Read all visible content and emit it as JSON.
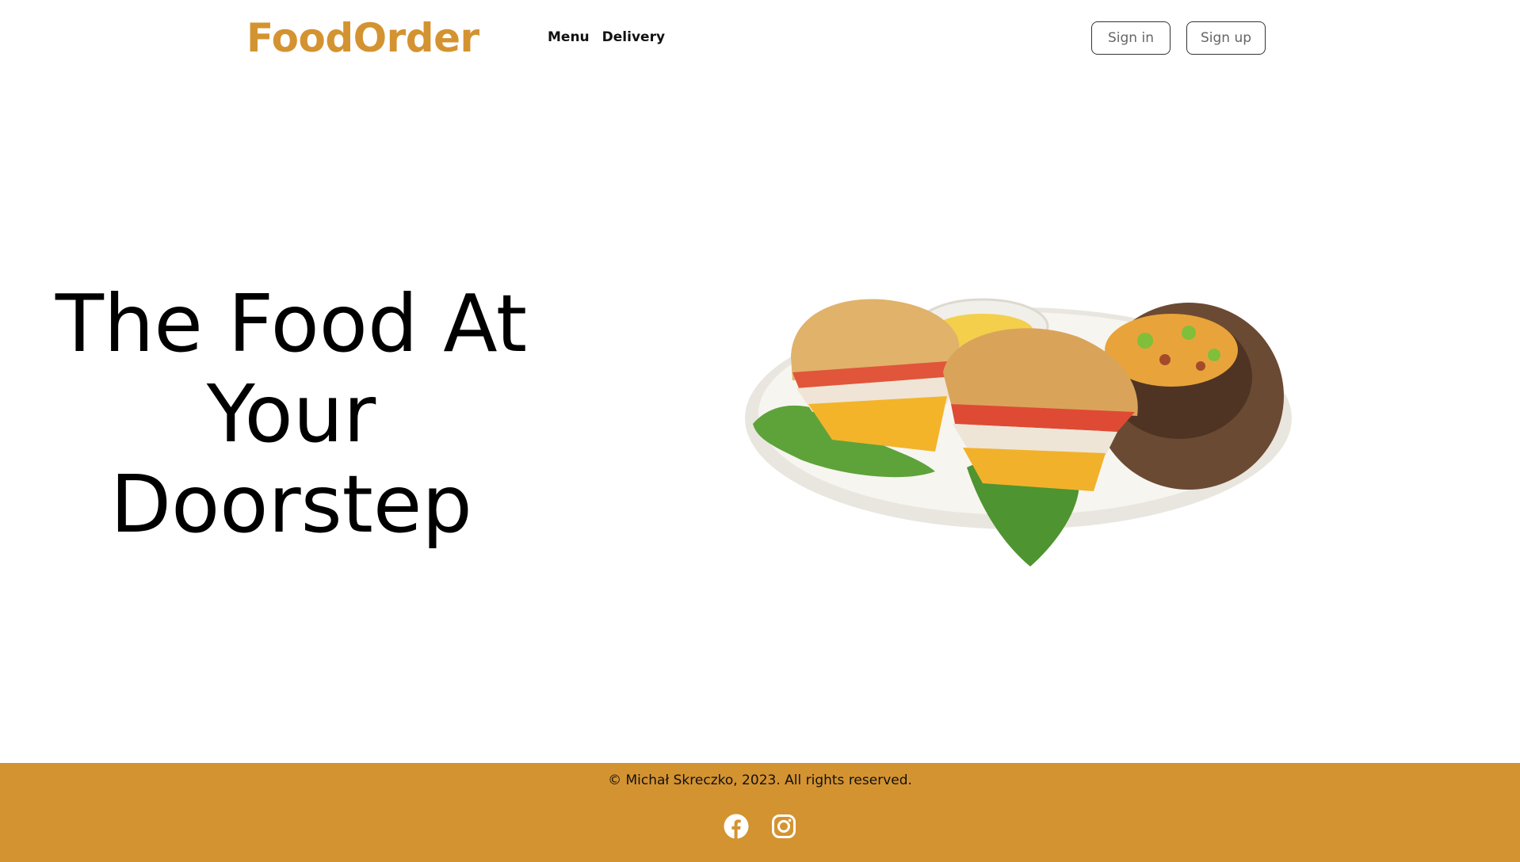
{
  "header": {
    "logo": "FoodOrder",
    "nav": [
      {
        "label": "Menu"
      },
      {
        "label": "Delivery"
      }
    ],
    "auth": {
      "signin_label": "Sign in",
      "signup_label": "Sign up"
    }
  },
  "hero": {
    "title_lines": [
      "The Food At",
      "Your",
      "Doorstep"
    ],
    "image_icon": "food-plate-image"
  },
  "footer": {
    "copyright": "© Michał Skreczko, 2023. All rights reserved.",
    "socials": [
      {
        "icon": "facebook-icon"
      },
      {
        "icon": "instagram-icon"
      }
    ]
  },
  "colors": {
    "brand": "#d49331",
    "background": "#ffffff",
    "text": "#000000"
  }
}
